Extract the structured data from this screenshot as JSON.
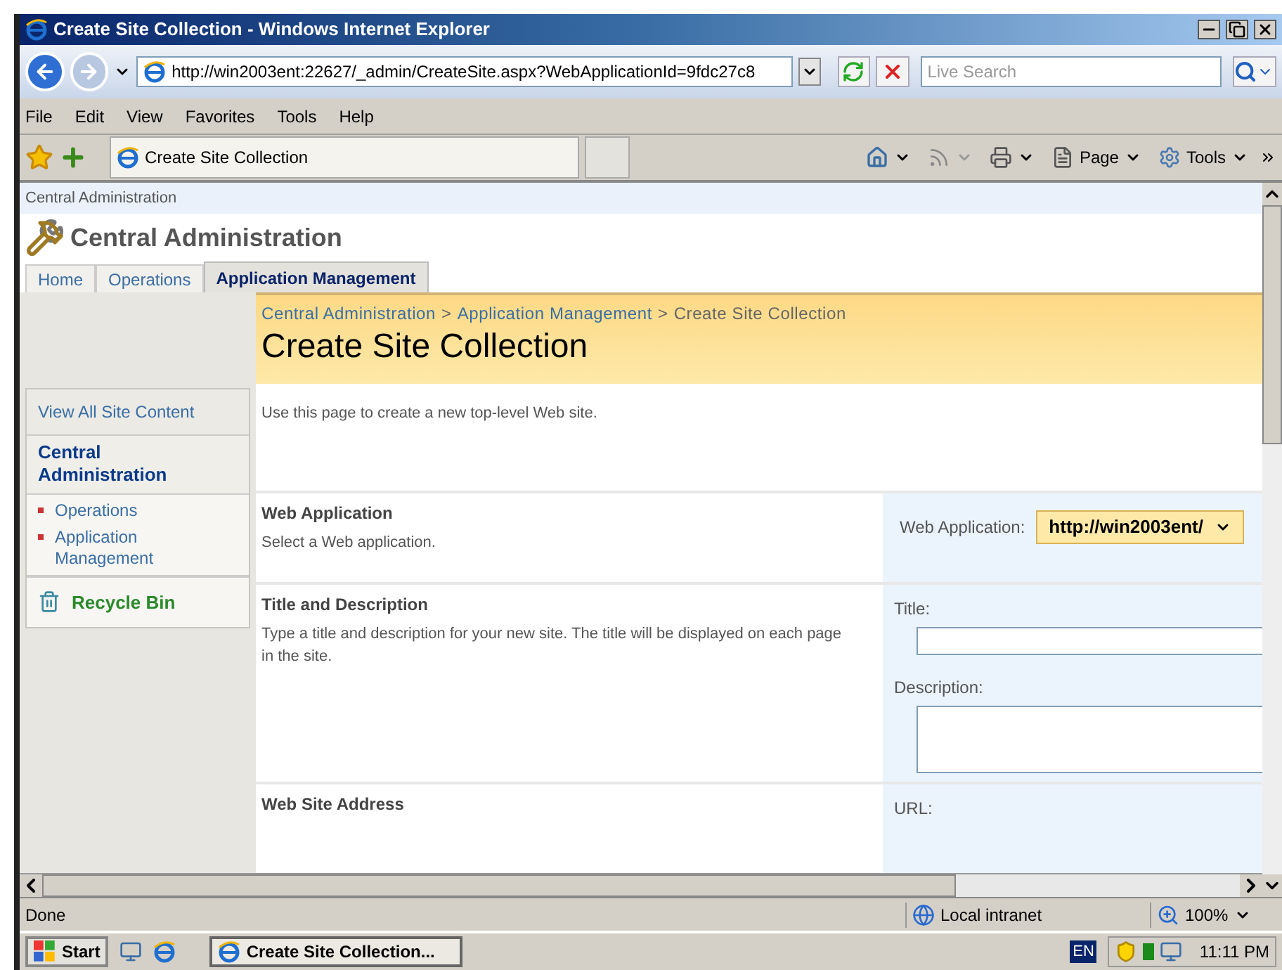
{
  "window": {
    "title": "Create Site Collection - Windows Internet Explorer"
  },
  "address_bar": {
    "url": "http://win2003ent:22627/_admin/CreateSite.aspx?WebApplicationId=9fdc27c8",
    "search_placeholder": "Live Search"
  },
  "menu": [
    "File",
    "Edit",
    "View",
    "Favorites",
    "Tools",
    "Help"
  ],
  "favorites_bar": {
    "tab": "Create Site Collection",
    "commands": [
      "Page",
      "Tools"
    ]
  },
  "site": {
    "top_link": "Central Administration",
    "title": "Central Administration",
    "tabs": [
      {
        "label": "Home",
        "selected": false
      },
      {
        "label": "Operations",
        "selected": false
      },
      {
        "label": "Application Management",
        "selected": true
      }
    ]
  },
  "sidebar": {
    "view_all": "View All Site Content",
    "heading": "Central Administration",
    "items": [
      "Operations",
      "Application Management"
    ],
    "recycle_bin": "Recycle Bin"
  },
  "breadcrumb": {
    "separator": ">",
    "items": [
      "Central Administration",
      "Application Management",
      "Create Site Collection"
    ]
  },
  "page_title": "Create Site Collection",
  "intro": "Use this page to create a new top-level Web site.",
  "sections": [
    {
      "heading": "Web Application",
      "description": "Select a Web application.",
      "fields": [
        {
          "kind": "select",
          "label": "Web Application:",
          "value": "http://win2003ent/"
        }
      ]
    },
    {
      "heading": "Title and Description",
      "description": "Type a title and description for your new site. The title will be displayed on each page in the site.",
      "fields": [
        {
          "kind": "text",
          "label": "Title:"
        },
        {
          "kind": "textarea",
          "label": "Description:"
        }
      ]
    },
    {
      "heading": "Web Site Address",
      "fields": [
        {
          "kind": "label",
          "label": "URL:"
        }
      ]
    }
  ],
  "status_bar": {
    "text": "Done",
    "zone": "Local intranet",
    "zoom": "100%"
  },
  "taskbar": {
    "start": "Start",
    "task": "Create Site Collection...",
    "language": "EN",
    "clock": "11:11 PM"
  }
}
